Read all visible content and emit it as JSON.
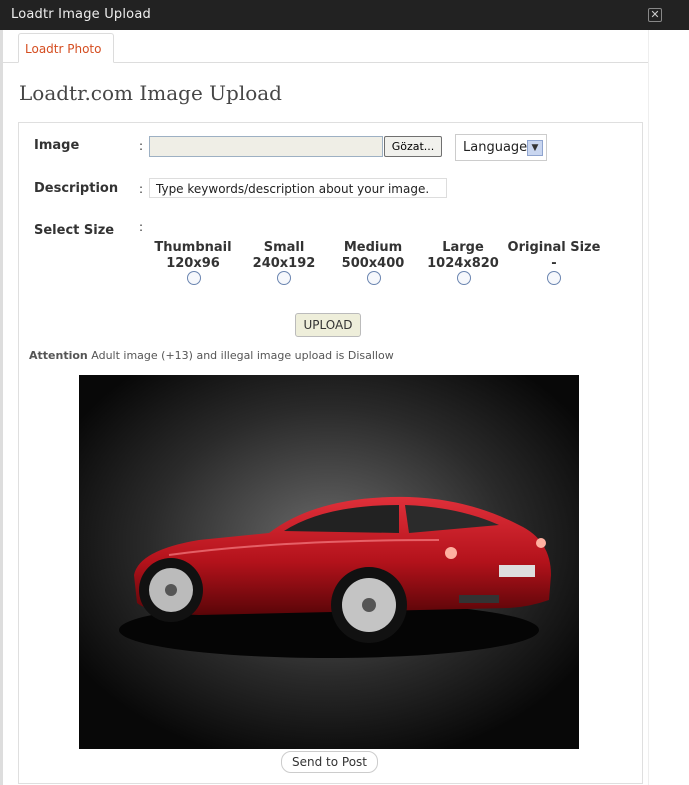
{
  "window": {
    "title": "Loadtr Image Upload",
    "close_glyph": "✕"
  },
  "tabs": [
    {
      "label": "Loadtr Photo"
    }
  ],
  "page_title": "Loadtr.com Image Upload",
  "form": {
    "image_label": "Image",
    "colon": ":",
    "file_value": "",
    "browse_label": "Gözat...",
    "language_value": "Language",
    "description_label": "Description",
    "description_value": "Type keywords/description about your image.",
    "size_label": "Select Size",
    "sizes": [
      {
        "name": "Thumbnail",
        "dims": "120x96"
      },
      {
        "name": "Small",
        "dims": "240x192"
      },
      {
        "name": "Medium",
        "dims": "500x400"
      },
      {
        "name": "Large",
        "dims": "1024x820"
      },
      {
        "name": "Original Size",
        "dims": "-"
      }
    ],
    "upload_label": "UPLOAD"
  },
  "notice": {
    "title": "Attention",
    "text": "Adult image (+13) and illegal image upload is Disallow"
  },
  "preview": {
    "subject": "red sports car",
    "car_color": "#b3121b"
  },
  "send_label": "Send to Post",
  "colors": {
    "titlebar": "#222222",
    "tab_text": "#d54e21",
    "heading": "#464646"
  }
}
